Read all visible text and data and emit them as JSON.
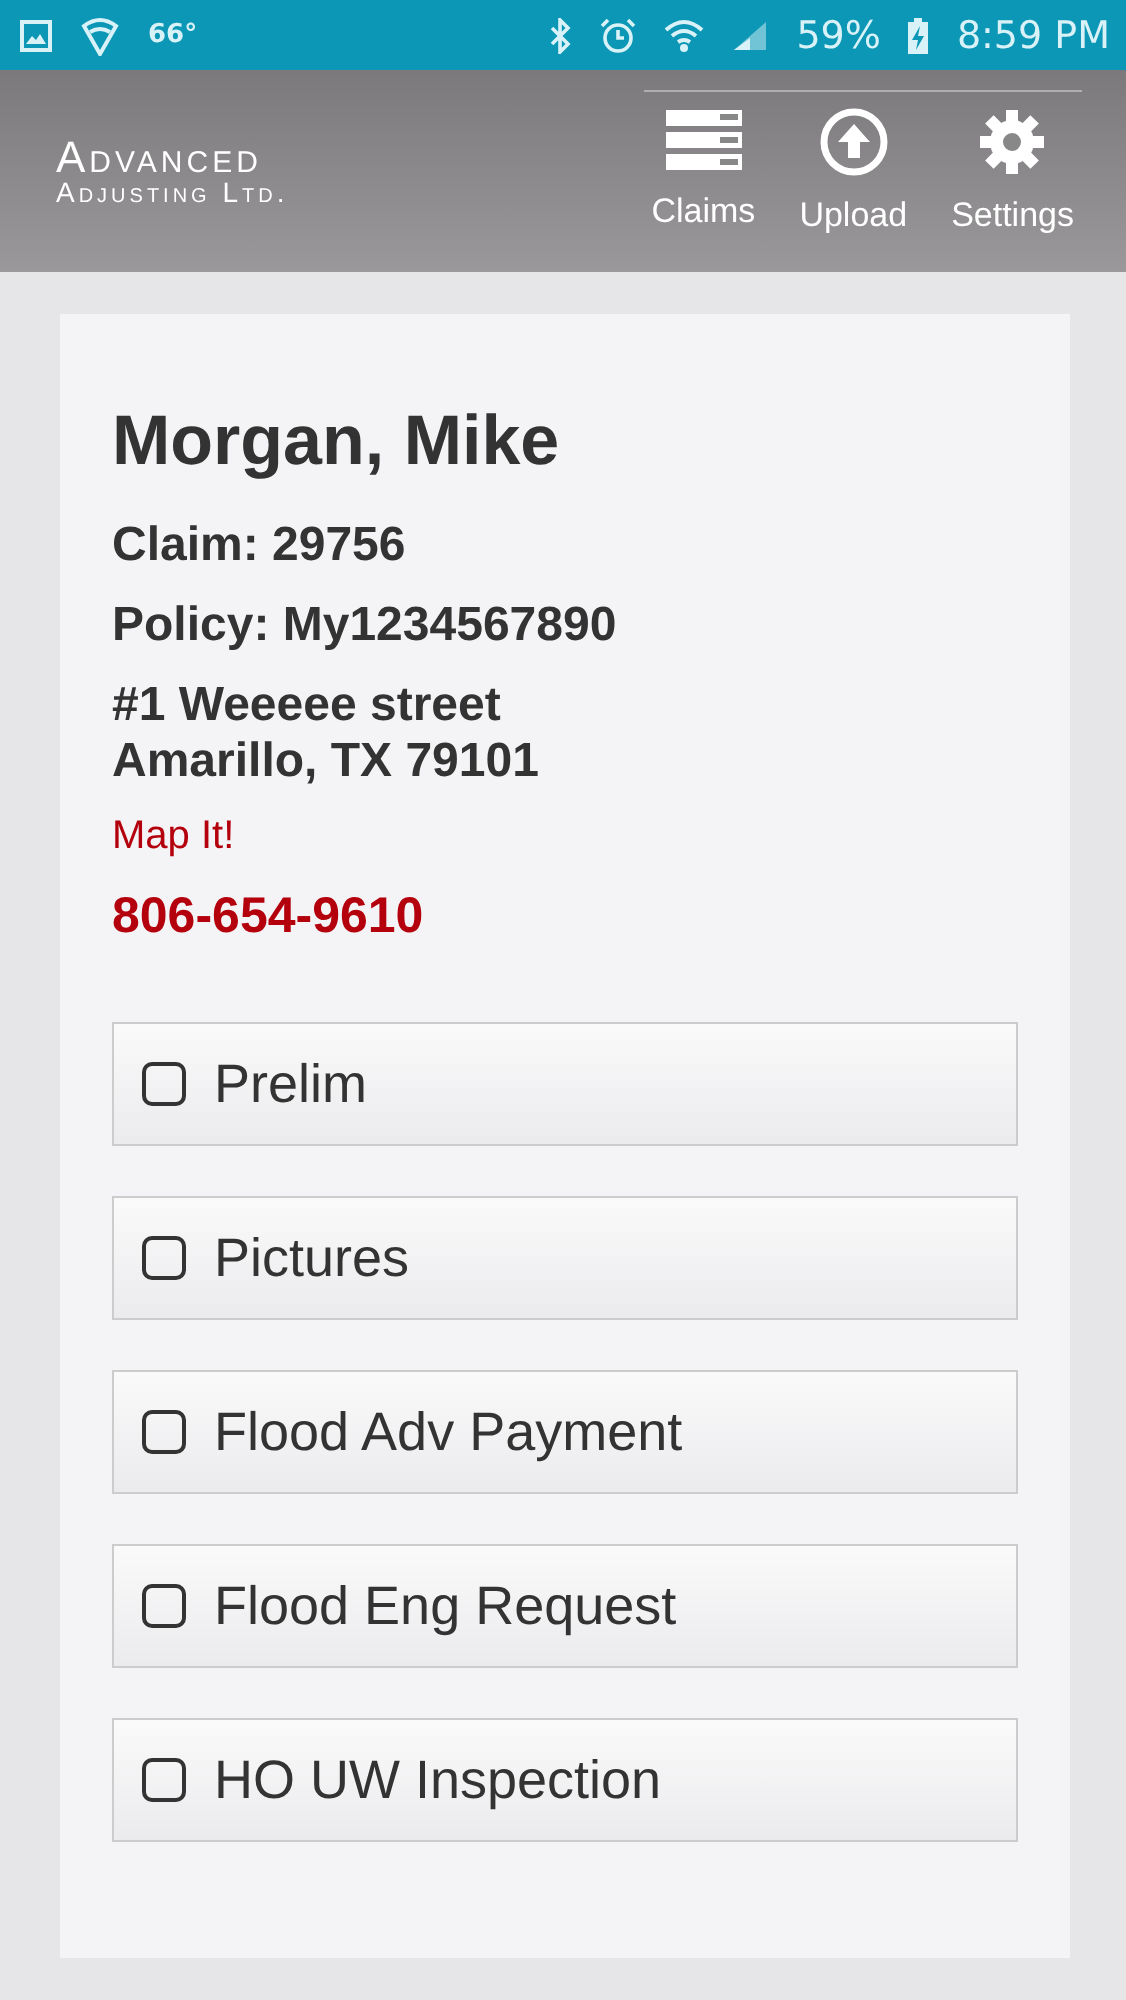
{
  "status_bar": {
    "temperature": "66°",
    "battery": "59%",
    "time": "8:59 PM"
  },
  "header": {
    "logo": {
      "line_1": "Advanced",
      "line_2": "Adjusting Ltd."
    },
    "actions": [
      {
        "kind": "claims",
        "label": "Claims"
      },
      {
        "kind": "upload",
        "label": "Upload"
      },
      {
        "kind": "settings",
        "label": "Settings"
      }
    ]
  },
  "claim": {
    "name": "Morgan, Mike",
    "claim": "Claim: 29756",
    "policy": "Policy: My1234567890",
    "address_line_1": "#1 Weeeee street",
    "address_line_2": "Amarillo, TX 79101",
    "map_link": "Map It!",
    "phone": "806-654-9610"
  },
  "checklist": [
    {
      "label": "Prelim",
      "checked": false
    },
    {
      "label": "Pictures",
      "checked": false
    },
    {
      "label": "Flood Adv Payment",
      "checked": false
    },
    {
      "label": "Flood Eng Request",
      "checked": false
    },
    {
      "label": "HO UW Inspection",
      "checked": false
    }
  ]
}
